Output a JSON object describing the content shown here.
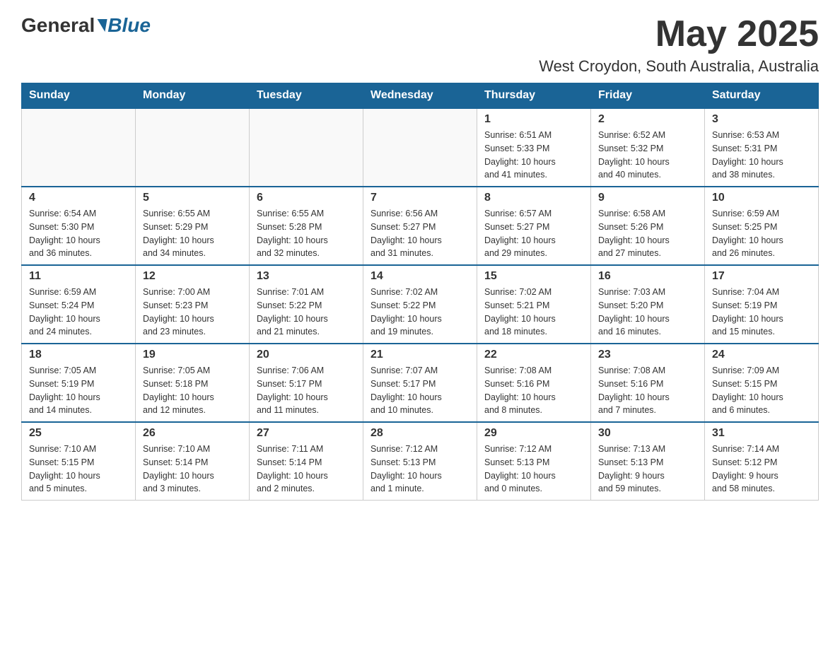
{
  "header": {
    "logo_general": "General",
    "logo_blue": "Blue",
    "month_title": "May 2025",
    "location": "West Croydon, South Australia, Australia"
  },
  "days_of_week": [
    "Sunday",
    "Monday",
    "Tuesday",
    "Wednesday",
    "Thursday",
    "Friday",
    "Saturday"
  ],
  "weeks": [
    [
      {
        "day": "",
        "info": ""
      },
      {
        "day": "",
        "info": ""
      },
      {
        "day": "",
        "info": ""
      },
      {
        "day": "",
        "info": ""
      },
      {
        "day": "1",
        "info": "Sunrise: 6:51 AM\nSunset: 5:33 PM\nDaylight: 10 hours\nand 41 minutes."
      },
      {
        "day": "2",
        "info": "Sunrise: 6:52 AM\nSunset: 5:32 PM\nDaylight: 10 hours\nand 40 minutes."
      },
      {
        "day": "3",
        "info": "Sunrise: 6:53 AM\nSunset: 5:31 PM\nDaylight: 10 hours\nand 38 minutes."
      }
    ],
    [
      {
        "day": "4",
        "info": "Sunrise: 6:54 AM\nSunset: 5:30 PM\nDaylight: 10 hours\nand 36 minutes."
      },
      {
        "day": "5",
        "info": "Sunrise: 6:55 AM\nSunset: 5:29 PM\nDaylight: 10 hours\nand 34 minutes."
      },
      {
        "day": "6",
        "info": "Sunrise: 6:55 AM\nSunset: 5:28 PM\nDaylight: 10 hours\nand 32 minutes."
      },
      {
        "day": "7",
        "info": "Sunrise: 6:56 AM\nSunset: 5:27 PM\nDaylight: 10 hours\nand 31 minutes."
      },
      {
        "day": "8",
        "info": "Sunrise: 6:57 AM\nSunset: 5:27 PM\nDaylight: 10 hours\nand 29 minutes."
      },
      {
        "day": "9",
        "info": "Sunrise: 6:58 AM\nSunset: 5:26 PM\nDaylight: 10 hours\nand 27 minutes."
      },
      {
        "day": "10",
        "info": "Sunrise: 6:59 AM\nSunset: 5:25 PM\nDaylight: 10 hours\nand 26 minutes."
      }
    ],
    [
      {
        "day": "11",
        "info": "Sunrise: 6:59 AM\nSunset: 5:24 PM\nDaylight: 10 hours\nand 24 minutes."
      },
      {
        "day": "12",
        "info": "Sunrise: 7:00 AM\nSunset: 5:23 PM\nDaylight: 10 hours\nand 23 minutes."
      },
      {
        "day": "13",
        "info": "Sunrise: 7:01 AM\nSunset: 5:22 PM\nDaylight: 10 hours\nand 21 minutes."
      },
      {
        "day": "14",
        "info": "Sunrise: 7:02 AM\nSunset: 5:22 PM\nDaylight: 10 hours\nand 19 minutes."
      },
      {
        "day": "15",
        "info": "Sunrise: 7:02 AM\nSunset: 5:21 PM\nDaylight: 10 hours\nand 18 minutes."
      },
      {
        "day": "16",
        "info": "Sunrise: 7:03 AM\nSunset: 5:20 PM\nDaylight: 10 hours\nand 16 minutes."
      },
      {
        "day": "17",
        "info": "Sunrise: 7:04 AM\nSunset: 5:19 PM\nDaylight: 10 hours\nand 15 minutes."
      }
    ],
    [
      {
        "day": "18",
        "info": "Sunrise: 7:05 AM\nSunset: 5:19 PM\nDaylight: 10 hours\nand 14 minutes."
      },
      {
        "day": "19",
        "info": "Sunrise: 7:05 AM\nSunset: 5:18 PM\nDaylight: 10 hours\nand 12 minutes."
      },
      {
        "day": "20",
        "info": "Sunrise: 7:06 AM\nSunset: 5:17 PM\nDaylight: 10 hours\nand 11 minutes."
      },
      {
        "day": "21",
        "info": "Sunrise: 7:07 AM\nSunset: 5:17 PM\nDaylight: 10 hours\nand 10 minutes."
      },
      {
        "day": "22",
        "info": "Sunrise: 7:08 AM\nSunset: 5:16 PM\nDaylight: 10 hours\nand 8 minutes."
      },
      {
        "day": "23",
        "info": "Sunrise: 7:08 AM\nSunset: 5:16 PM\nDaylight: 10 hours\nand 7 minutes."
      },
      {
        "day": "24",
        "info": "Sunrise: 7:09 AM\nSunset: 5:15 PM\nDaylight: 10 hours\nand 6 minutes."
      }
    ],
    [
      {
        "day": "25",
        "info": "Sunrise: 7:10 AM\nSunset: 5:15 PM\nDaylight: 10 hours\nand 5 minutes."
      },
      {
        "day": "26",
        "info": "Sunrise: 7:10 AM\nSunset: 5:14 PM\nDaylight: 10 hours\nand 3 minutes."
      },
      {
        "day": "27",
        "info": "Sunrise: 7:11 AM\nSunset: 5:14 PM\nDaylight: 10 hours\nand 2 minutes."
      },
      {
        "day": "28",
        "info": "Sunrise: 7:12 AM\nSunset: 5:13 PM\nDaylight: 10 hours\nand 1 minute."
      },
      {
        "day": "29",
        "info": "Sunrise: 7:12 AM\nSunset: 5:13 PM\nDaylight: 10 hours\nand 0 minutes."
      },
      {
        "day": "30",
        "info": "Sunrise: 7:13 AM\nSunset: 5:13 PM\nDaylight: 9 hours\nand 59 minutes."
      },
      {
        "day": "31",
        "info": "Sunrise: 7:14 AM\nSunset: 5:12 PM\nDaylight: 9 hours\nand 58 minutes."
      }
    ]
  ]
}
